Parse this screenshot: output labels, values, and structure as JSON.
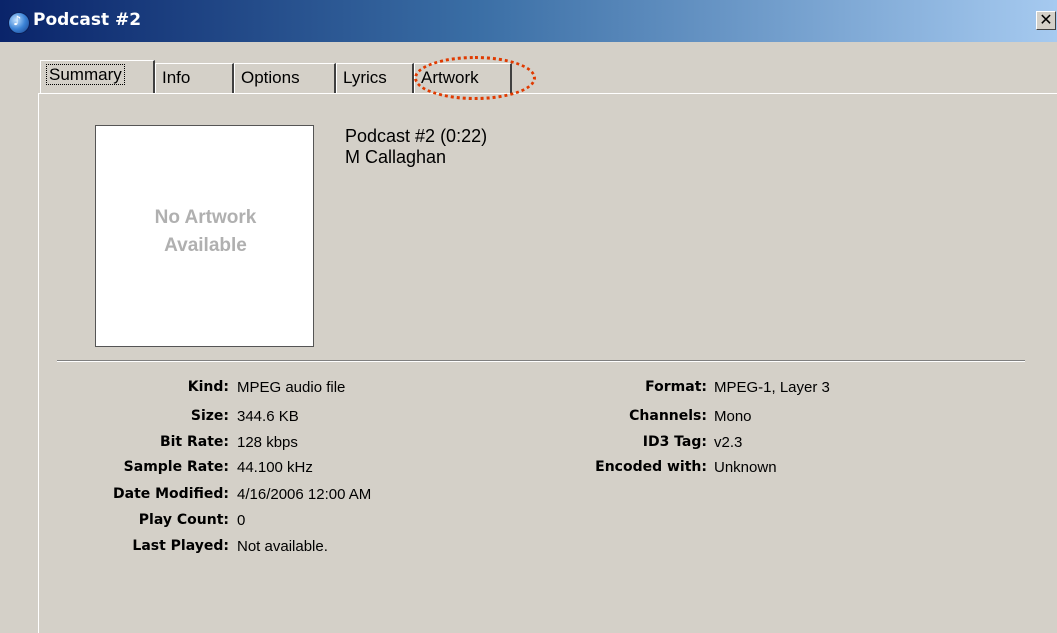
{
  "window": {
    "title": "Podcast #2",
    "close_glyph": "✕"
  },
  "tabs": [
    {
      "label": "Summary",
      "active": true
    },
    {
      "label": "Info",
      "active": false
    },
    {
      "label": "Options",
      "active": false
    },
    {
      "label": "Lyrics",
      "active": false
    },
    {
      "label": "Artwork",
      "active": false,
      "highlighted": true
    }
  ],
  "artwork": {
    "placeholder_line1": "No Artwork",
    "placeholder_line2": "Available"
  },
  "track": {
    "name": "Podcast #2 (0:22)",
    "artist": "M Callaghan"
  },
  "details_left": [
    {
      "label": "Kind:",
      "value": "MPEG audio file"
    },
    {
      "label": "Size:",
      "value": "344.6 KB"
    },
    {
      "label": "Bit Rate:",
      "value": "128 kbps"
    },
    {
      "label": "Sample Rate:",
      "value": "44.100 kHz"
    },
    {
      "label": "Date Modified:",
      "value": "4/16/2006 12:00 AM"
    },
    {
      "label": "Play Count:",
      "value": "0"
    },
    {
      "label": "Last Played:",
      "value": "Not available."
    }
  ],
  "details_right": [
    {
      "label": "Format:",
      "value": "MPEG-1, Layer 3"
    },
    {
      "label": "Channels:",
      "value": "Mono"
    },
    {
      "label": "ID3 Tag:",
      "value": "v2.3"
    },
    {
      "label": "Encoded with:",
      "value": "Unknown"
    }
  ],
  "colors": {
    "highlight_ring": "#e03a00",
    "titlebar_start": "#0a246a",
    "titlebar_end": "#a6caf0"
  }
}
